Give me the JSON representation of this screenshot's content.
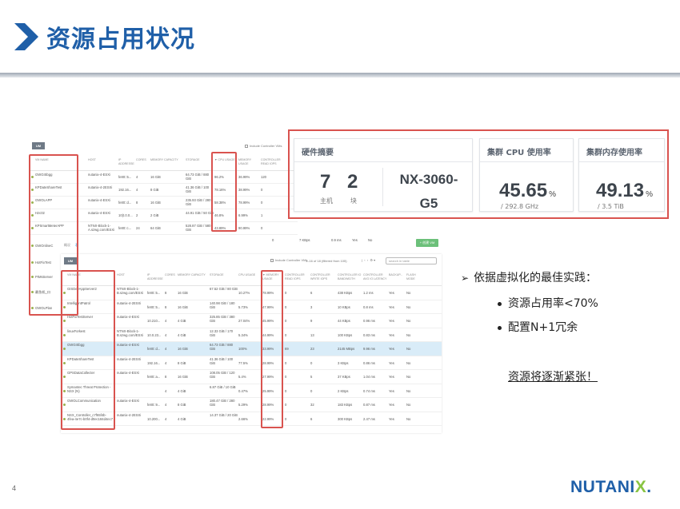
{
  "title": "资源占用状况",
  "page_number": "4",
  "logo": {
    "before": "NUTANI",
    "x": "X",
    "after": "."
  },
  "cards": {
    "hardware": {
      "title": "硬件摘要",
      "hosts_value": "7",
      "hosts_label": "主机",
      "blocks_value": "2",
      "blocks_label": "块",
      "model_line1": "NX-3060-",
      "model_line2": "G5"
    },
    "cpu": {
      "title": "集群 CPU 使用率",
      "value": "45.65",
      "unit": "%",
      "sub": "/ 292.8 GHz"
    },
    "mem": {
      "title": "集群内存使用率",
      "value": "49.13",
      "unit": "%",
      "sub": "/ 3.5 TiB"
    }
  },
  "notes": {
    "heading": "依据虚拟化的最佳实践：",
    "bullets": [
      "资源占用率<70%",
      "配置N+1冗余"
    ],
    "warning": "资源将逐渐紧张！"
  },
  "screenshot": {
    "um_button": "UM",
    "include_cvm": "Include Controller VMs",
    "pager_text": "1–16 of 18 (filtered from 105)",
    "search_placeholder": "search in table",
    "tabs": [
      "概况",
      "表"
    ],
    "green_button": "+ 创建 VM",
    "table1": {
      "headers": [
        "VM NAME",
        "HOST",
        "IP ADDRESSES",
        "CORES",
        "MEMORY CAPACITY",
        "STORAGE",
        "▼ CPU USAGE",
        "MEMORY USAGE",
        "CONTROLLER READ IOPS"
      ],
      "rows": [
        [
          "GWGISbgg",
          "nutanix-4-ESXi",
          "fe80::5...",
          "4",
          "16 GiB",
          "64.73 GiB / 880 GiB",
          "96.2%",
          "36.99%",
          "120"
        ],
        [
          "KPDateShareTest",
          "nutanix-4-2ESXi",
          "192.16...",
          "4",
          "8 GiB",
          "41.36 GiB / 100 GiB",
          "78.16%",
          "38.99%",
          "0"
        ],
        [
          "GWOLAPP",
          "nutanix-4-ESXi",
          "fe80::d...",
          "8",
          "16 GiB",
          "235.93 GiB / 280 GiB",
          "58.38%",
          "78.99%",
          "0"
        ],
        [
          "Hzc02",
          "nutanix-4-ESXi",
          "10(t.0.0...",
          "2",
          "2 GiB",
          "44.91 GiB / 50 GiB",
          "46.8%",
          "6.99%",
          "1"
        ],
        [
          "KPSmartMeterAPP",
          "NTNX-Block-1-A.szwg.com/ESXi",
          "fe80::c...",
          "24",
          "64 GiB",
          "528.87 GiB / 580 GiB",
          "43.89%",
          "90.99%",
          "0"
        ]
      ],
      "extra_names": [
        "GWOnlineC",
        "HotFixTest",
        "PIMsServer",
        "最急机_口",
        "GWOLPlan"
      ],
      "partial_tail": [
        "0",
        "7 KBps",
        "0.9 ms",
        "Yes",
        "No"
      ]
    },
    "table2": {
      "headers": [
        "VM NAME",
        "HOST",
        "IP ADDRESSES",
        "CORES",
        "MEMORY CAPACITY",
        "STORAGE",
        "CPU USAGE",
        "▼ MEMORY USAGE",
        "CONTROLLER READ IOPS",
        "CONTROLLER WRITE IOPS",
        "CONTROLLER IO BANDWIDTH",
        "CONTROLLER AVG IO LATENCY",
        "BACKUP...",
        "FLASH MODE"
      ],
      "rows": [
        [
          "GISDevAppServer2",
          "NTNX-Block-1-B.szwg.com/ESXi",
          "fe80::5...",
          "8",
          "16 GiB",
          "67.52 GiB / 80 GiB",
          "10.27%",
          "78.99%",
          "0",
          "6",
          "438 KBps",
          "1.2 ms",
          "Yes",
          "No"
        ],
        [
          "IntelligentPatrol",
          "nutanix-4-2ESXi",
          "fe80::5...",
          "8",
          "16 GiB",
          "140.98 GiB / 180 GiB",
          "5.73%",
          "47.99%",
          "0",
          "3",
          "10 KBps",
          "0.8 ms",
          "Yes",
          "No"
        ],
        [
          "HotFixTestServer",
          "nutanix-4-ESXi",
          "10.210...",
          "4",
          "4 GiB",
          "325.85 GiB / 380 GiB",
          "27.04%",
          "45.99%",
          "0",
          "9",
          "44 KBps",
          "0.96 ms",
          "Yes",
          "No"
        ],
        [
          "linuxForkest",
          "NTNX-Block-1-B.szwg.com/ESXi",
          "10.0.23...",
          "4",
          "4 GiB",
          "12.33 GiB / 170 GiB",
          "5.34%",
          "44.99%",
          "0",
          "13",
          "100 KBps",
          "0.83 ms",
          "Yes",
          "No"
        ],
        [
          "GWGISbgg",
          "nutanix-4-ESXi",
          "fe80::d...",
          "4",
          "16 GiB",
          "64.73 GiB / 880 GiB",
          "100%",
          "33.99%",
          "69",
          "23",
          "2145 MBps",
          "9.96 ms",
          "Yes",
          "No"
        ],
        [
          "KPDateShareTest",
          "nutanix-4-2ESXi",
          "192.16...",
          "4",
          "8 GiB",
          "41.36 GiB / 100 GiB",
          "77.5%",
          "28.99%",
          "0",
          "0",
          "3 KBps",
          "0.86 ms",
          "Yes",
          "No"
        ],
        [
          "GPSDataCollecter",
          "nutanix-4-ESXi",
          "fe80::a...",
          "8",
          "16 GiB",
          "108.05 GiB / 120 GiB",
          "5.4%",
          "27.99%",
          "0",
          "5",
          "37 KBps",
          "1.04 ms",
          "Yes",
          "No"
        ],
        [
          "Symantec Threat Protection - NSX (N)",
          "",
          "",
          "4",
          "4 GiB",
          "6.87 GiB / 10 GiB",
          "0.47%",
          "25.99%",
          "0",
          "0",
          "2 KBps",
          "0.74 ms",
          "Yes",
          "No"
        ],
        [
          "GWOLCommunication",
          "nutanix-4-ESXi",
          "fe80::9...",
          "4",
          "8 GiB",
          "180.47 GiB / 280 GiB",
          "5.29%",
          "28.99%",
          "0",
          "32",
          "183 KBps",
          "0.87 ms",
          "Yes",
          "No"
        ],
        [
          "NSX_Controller_c7f65f4b-4fea-4e7c-b0f4-d0ec184d4ec7",
          "nutanix-4-2ESXi",
          "10.200...",
          "4",
          "4 GiB",
          "14.37 GiB / 20 GiB",
          "2.66%",
          "22.99%",
          "0",
          "6",
          "300 KBps",
          "2.47 ms",
          "Yes",
          "No"
        ]
      ]
    }
  }
}
